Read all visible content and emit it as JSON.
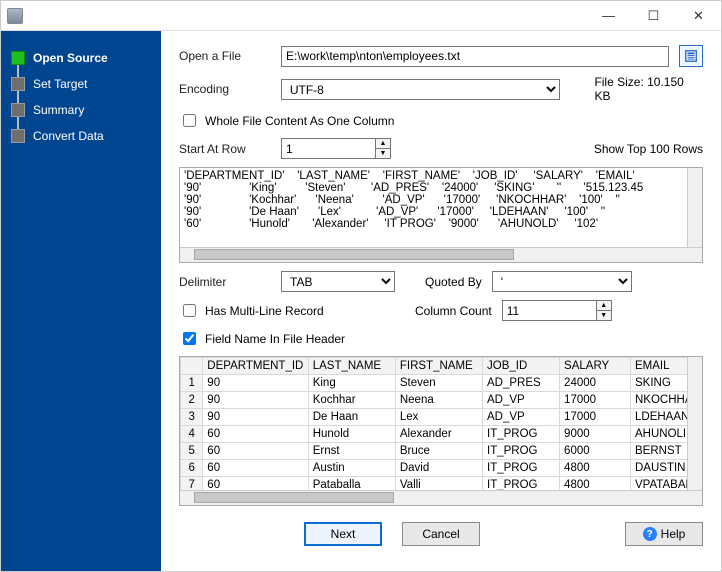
{
  "window": {
    "minimize": "—",
    "maximize": "☐",
    "close": "✕"
  },
  "sidebar": {
    "items": [
      {
        "label": "Open Source",
        "active": true
      },
      {
        "label": "Set Target",
        "active": false
      },
      {
        "label": "Summary",
        "active": false
      },
      {
        "label": "Convert Data",
        "active": false
      }
    ]
  },
  "fields": {
    "open_file_label": "Open a File",
    "file_path": "E:\\work\\temp\\nton\\employees.txt",
    "encoding_label": "Encoding",
    "encoding_value": "UTF-8",
    "file_size_label": "File Size: 10.150 KB",
    "whole_file_label": "Whole File Content As One Column",
    "whole_file_checked": false,
    "start_row_label": "Start At Row",
    "start_row_value": "1",
    "show_top_label": "Show Top 100 Rows",
    "delimiter_label": "Delimiter",
    "delimiter_value": "TAB",
    "quoted_label": "Quoted By",
    "quoted_value": "'",
    "multiline_label": "Has Multi-Line Record",
    "multiline_checked": false,
    "column_count_label": "Column Count",
    "column_count_value": "11",
    "header_label": "Field Name In File Header",
    "header_checked": true
  },
  "raw_preview": {
    "lines": [
      "'DEPARTMENT_ID'\t'LAST_NAME'\t'FIRST_NAME'\t'JOB_ID'\t'SALARY'\t'EMAIL'",
      "'90'\t'King'\t'Steven'\t'AD_PRES'\t'24000'\t'SKING'\t''\t'515.123.45",
      "'90'\t'Kochhar'\t'Neena'\t'AD_VP'\t'17000'\t'NKOCHHAR'\t'100'\t''",
      "'90'\t'De Haan'\t'Lex'\t'AD_VP'\t'17000'\t'LDEHAAN'\t'100'\t''",
      "'60'\t'Hunold'\t'Alexander'\t'IT PROG'\t'9000'\t'AHUNOLD'\t'102'"
    ]
  },
  "grid": {
    "columns": [
      "DEPARTMENT_ID",
      "LAST_NAME",
      "FIRST_NAME",
      "JOB_ID",
      "SALARY",
      "EMAIL"
    ],
    "rows": [
      [
        "90",
        "King",
        "Steven",
        "AD_PRES",
        "24000",
        "SKING"
      ],
      [
        "90",
        "Kochhar",
        "Neena",
        "AD_VP",
        "17000",
        "NKOCHHA"
      ],
      [
        "90",
        "De Haan",
        "Lex",
        "AD_VP",
        "17000",
        "LDEHAAN"
      ],
      [
        "60",
        "Hunold",
        "Alexander",
        "IT_PROG",
        "9000",
        "AHUNOLI"
      ],
      [
        "60",
        "Ernst",
        "Bruce",
        "IT_PROG",
        "6000",
        "BERNST"
      ],
      [
        "60",
        "Austin",
        "David",
        "IT_PROG",
        "4800",
        "DAUSTIN"
      ],
      [
        "60",
        "Pataballa",
        "Valli",
        "IT_PROG",
        "4800",
        "VPATABAL"
      ]
    ]
  },
  "footer": {
    "next": "Next",
    "cancel": "Cancel",
    "help": "Help"
  }
}
